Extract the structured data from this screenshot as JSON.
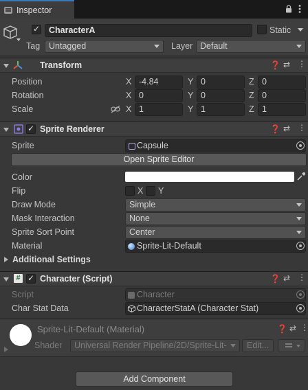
{
  "tab": {
    "label": "Inspector"
  },
  "gameobject": {
    "name": "CharacterA",
    "static_label": "Static",
    "tag_label": "Tag",
    "tag_value": "Untagged",
    "layer_label": "Layer",
    "layer_value": "Default"
  },
  "transform": {
    "title": "Transform",
    "position": {
      "label": "Position",
      "x": "-4.84",
      "y": "0",
      "z": "0"
    },
    "rotation": {
      "label": "Rotation",
      "x": "0",
      "y": "0",
      "z": "0"
    },
    "scale": {
      "label": "Scale",
      "x": "1",
      "y": "1",
      "z": "1"
    },
    "axis_labels": {
      "x": "X",
      "y": "Y",
      "z": "Z"
    }
  },
  "sprite_renderer": {
    "title": "Sprite Renderer",
    "sprite_label": "Sprite",
    "sprite_value": "Capsule",
    "open_editor_label": "Open Sprite Editor",
    "color_label": "Color",
    "color_value": "#ffffff",
    "flip_label": "Flip",
    "flip_x": "X",
    "flip_y": "Y",
    "draw_mode_label": "Draw Mode",
    "draw_mode_value": "Simple",
    "mask_label": "Mask Interaction",
    "mask_value": "None",
    "sort_point_label": "Sprite Sort Point",
    "sort_point_value": "Center",
    "material_label": "Material",
    "material_value": "Sprite-Lit-Default",
    "additional_label": "Additional Settings"
  },
  "character_script": {
    "title": "Character (Script)",
    "script_label": "Script",
    "script_value": "Character",
    "stat_label": "Char Stat Data",
    "stat_value": "CharacterStatA (Character Stat)"
  },
  "material": {
    "title": "Sprite-Lit-Default (Material)",
    "shader_label": "Shader",
    "shader_value": "Universal Render Pipeline/2D/Sprite-Lit-",
    "edit_label": "Edit..."
  },
  "add_component_label": "Add Component"
}
